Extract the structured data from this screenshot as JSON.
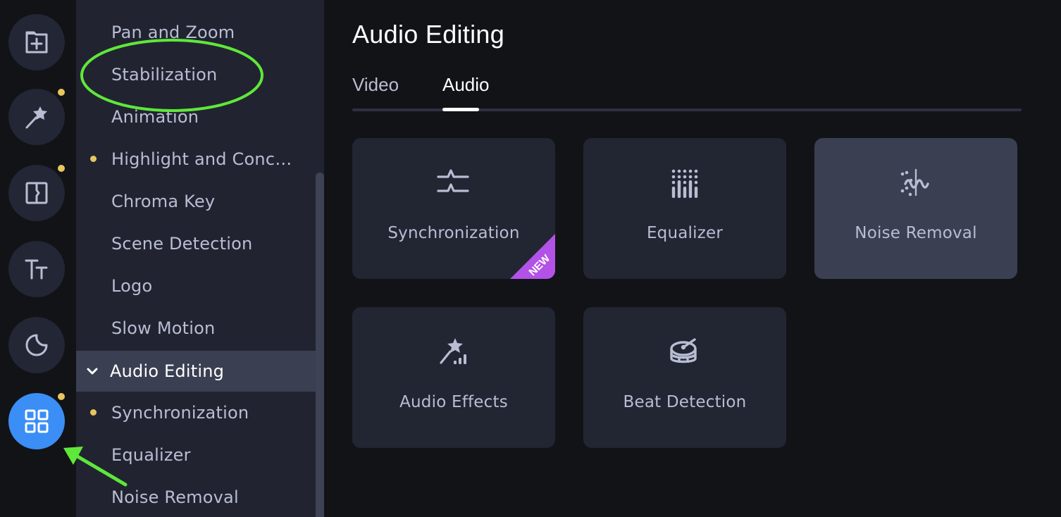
{
  "colors": {
    "accent": "#3b8ef5",
    "notification_dot": "#e8c55f",
    "new_badge": "#b252e6",
    "annotation": "#5ee83a"
  },
  "rail": {
    "items": [
      {
        "icon": "folder-add-icon",
        "active": false,
        "has_dot": false
      },
      {
        "icon": "magic-wand-icon",
        "active": false,
        "has_dot": true
      },
      {
        "icon": "split-icon",
        "active": false,
        "has_dot": true
      },
      {
        "icon": "text-icon",
        "active": false,
        "has_dot": false
      },
      {
        "icon": "sticker-icon",
        "active": false,
        "has_dot": false
      },
      {
        "icon": "grid-icon",
        "active": true,
        "has_dot": true
      }
    ]
  },
  "sidebar": {
    "items": [
      {
        "label": "Pan and Zoom",
        "dot": false
      },
      {
        "label": "Stabilization",
        "dot": false
      },
      {
        "label": "Animation",
        "dot": false
      },
      {
        "label": "Highlight and Conc…",
        "dot": true
      },
      {
        "label": "Chroma Key",
        "dot": false
      },
      {
        "label": "Scene Detection",
        "dot": false
      },
      {
        "label": "Logo",
        "dot": false
      },
      {
        "label": "Slow Motion",
        "dot": false
      },
      {
        "label": "Audio Editing",
        "dot": false,
        "group": true,
        "expanded": true
      },
      {
        "label": "Synchronization",
        "dot": true
      },
      {
        "label": "Equalizer",
        "dot": false
      },
      {
        "label": "Noise Removal",
        "dot": false
      }
    ]
  },
  "main": {
    "title": "Audio Editing",
    "tabs": [
      {
        "label": "Video",
        "active": false
      },
      {
        "label": "Audio",
        "active": true
      }
    ],
    "cards": [
      {
        "label": "Synchronization",
        "icon": "sync-waves-icon",
        "badge": "NEW"
      },
      {
        "label": "Equalizer",
        "icon": "equalizer-icon"
      },
      {
        "label": "Noise Removal",
        "icon": "noise-removal-icon",
        "hovered": true
      },
      {
        "label": "Audio Effects",
        "icon": "audio-effects-wand-icon"
      },
      {
        "label": "Beat Detection",
        "icon": "drum-icon"
      }
    ]
  }
}
